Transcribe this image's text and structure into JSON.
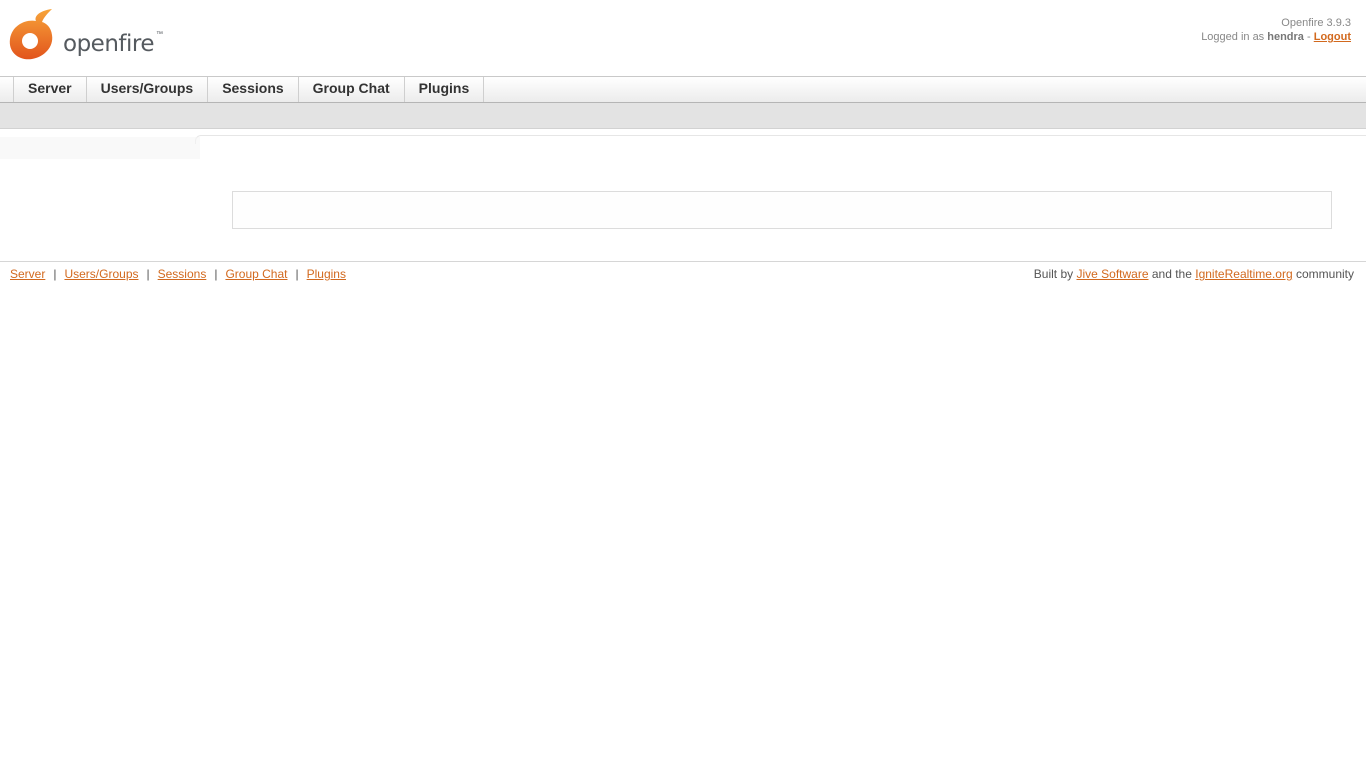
{
  "header": {
    "logo_text": "openfire",
    "logo_tm": "™",
    "version": "Openfire 3.9.3",
    "logged_in_prefix": "Logged in as",
    "username": "hendra",
    "separator": "-",
    "logout_label": "Logout"
  },
  "nav": {
    "tabs": [
      {
        "label": "Server"
      },
      {
        "label": "Users/Groups"
      },
      {
        "label": "Sessions"
      },
      {
        "label": "Group Chat"
      },
      {
        "label": "Plugins"
      }
    ]
  },
  "footer": {
    "links": [
      {
        "label": "Server"
      },
      {
        "label": "Users/Groups"
      },
      {
        "label": "Sessions"
      },
      {
        "label": "Group Chat"
      },
      {
        "label": "Plugins"
      }
    ],
    "link_separator": "|",
    "credit_prefix": "Built by",
    "credit_link1": "Jive Software",
    "credit_middle": "and the",
    "credit_link2": "IgniteRealtime.org",
    "credit_suffix": "community"
  },
  "colors": {
    "accent": "#d2691e",
    "logo_orange": "#f08a24"
  },
  "icons": {
    "logo": "openfire-flame-logo"
  }
}
